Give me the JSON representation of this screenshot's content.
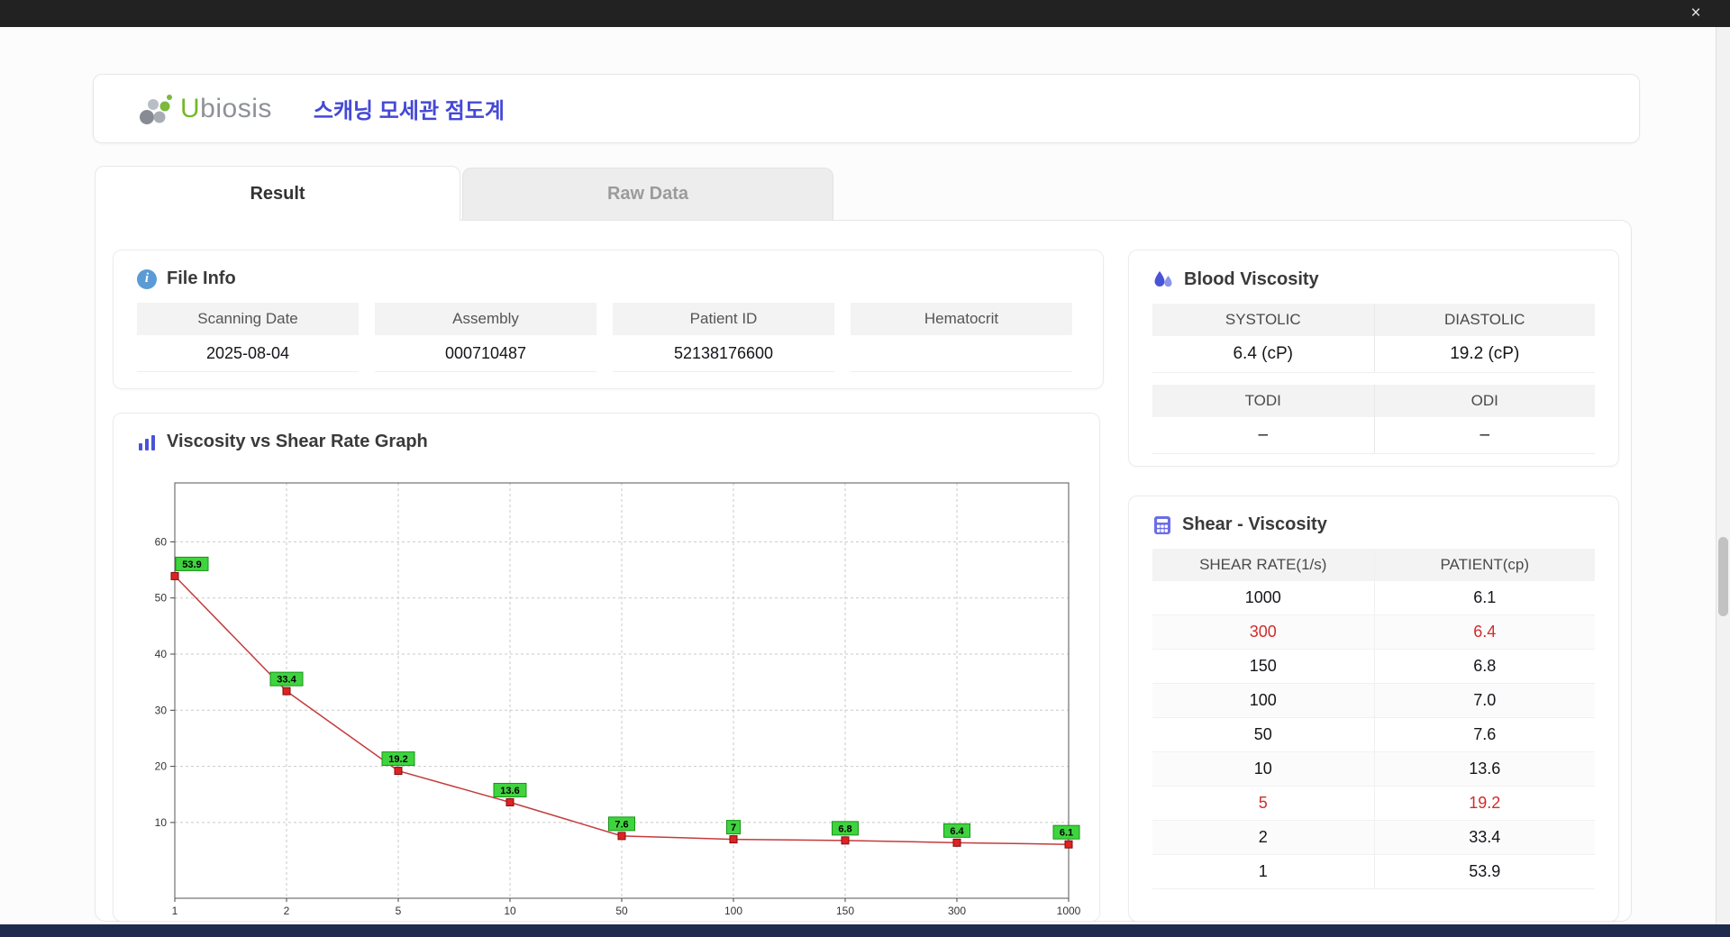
{
  "window": {
    "close_label": "×"
  },
  "header": {
    "logo_u": "U",
    "logo_rest": "biosis",
    "app_title": "스캐닝 모세관 점도계"
  },
  "tabs": [
    {
      "label": "Result",
      "active": true
    },
    {
      "label": "Raw Data",
      "active": false
    }
  ],
  "file_info": {
    "title": "File Info",
    "fields": [
      {
        "label": "Scanning Date",
        "value": "2025-08-04"
      },
      {
        "label": "Assembly",
        "value": "000710487"
      },
      {
        "label": "Patient ID",
        "value": "52138176600"
      },
      {
        "label": "Hematocrit",
        "value": ""
      }
    ]
  },
  "blood_viscosity": {
    "title": "Blood Viscosity",
    "cells": [
      {
        "label": "SYSTOLIC",
        "value": "6.4 (cP)"
      },
      {
        "label": "DIASTOLIC",
        "value": "19.2 (cP)"
      },
      {
        "label": "TODI",
        "value": "–"
      },
      {
        "label": "ODI",
        "value": "–"
      }
    ]
  },
  "shear_viscosity": {
    "title": "Shear - Viscosity",
    "columns": [
      "SHEAR RATE(1/s)",
      "PATIENT(cp)"
    ],
    "highlight_color": "#d02c2c",
    "rows": [
      {
        "shear_rate": "1000",
        "patient": "6.1",
        "highlight": false
      },
      {
        "shear_rate": "300",
        "patient": "6.4",
        "highlight": true
      },
      {
        "shear_rate": "150",
        "patient": "6.8",
        "highlight": false
      },
      {
        "shear_rate": "100",
        "patient": "7.0",
        "highlight": false
      },
      {
        "shear_rate": "50",
        "patient": "7.6",
        "highlight": false
      },
      {
        "shear_rate": "10",
        "patient": "13.6",
        "highlight": false
      },
      {
        "shear_rate": "5",
        "patient": "19.2",
        "highlight": true
      },
      {
        "shear_rate": "2",
        "patient": "33.4",
        "highlight": false
      },
      {
        "shear_rate": "1",
        "patient": "53.9",
        "highlight": false
      }
    ]
  },
  "chart_data": {
    "type": "line",
    "title": "Viscosity vs Shear Rate Graph",
    "xlabel": "",
    "ylabel": "",
    "categories": [
      "1",
      "2",
      "5",
      "10",
      "50",
      "100",
      "150",
      "300",
      "1000"
    ],
    "values": [
      53.9,
      33.4,
      19.2,
      13.6,
      7.6,
      7,
      6.8,
      6.4,
      6.1
    ],
    "point_labels": [
      "53.9",
      "33.4",
      "19.2",
      "13.6",
      "7.6",
      "7",
      "6.8",
      "6.4",
      "6.1"
    ],
    "y_ticks": [
      10,
      20,
      30,
      40,
      50,
      60
    ],
    "ylim": [
      -3.5,
      70.5
    ],
    "grid": "dashed",
    "legend": "none",
    "line_color": "#c43c3c",
    "marker_color": "#e02222",
    "point_label_bg": "#3fd43f"
  }
}
